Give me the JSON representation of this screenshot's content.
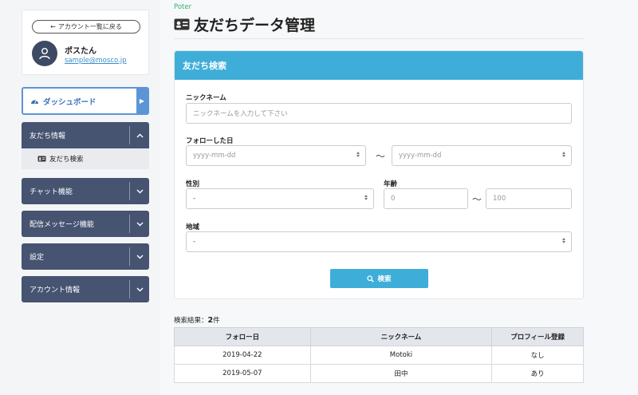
{
  "sidebar": {
    "back_label": "アカウント一覧に戻る",
    "user_name": "ポスたん",
    "user_email": "sample@mosco.jp",
    "dashboard_label": "ダッシュボード",
    "menu": [
      {
        "label": "友だち情報"
      },
      {
        "label": "チャット機能"
      },
      {
        "label": "配信メッセージ機能"
      },
      {
        "label": "設定"
      },
      {
        "label": "アカウント情報"
      }
    ],
    "submenu_item": "友だち検索",
    "accent_color": "#465371"
  },
  "header": {
    "app_name": "Poter",
    "page_title": "友だちデータ管理"
  },
  "search": {
    "panel_title": "友だち検索",
    "nickname_label": "ニックネーム",
    "nickname_placeholder": "ニックネームを入力して下さい",
    "follow_date_label": "フォローした日",
    "date_from_placeholder": "yyyy-mm-dd",
    "date_to_placeholder": "yyyy-mm-dd",
    "range_sep": "〜",
    "gender_label": "性別",
    "gender_value": "-",
    "age_label": "年齢",
    "age_from": "0",
    "age_to": "100",
    "region_label": "地域",
    "region_value": "-",
    "search_button": "検索",
    "accent_color": "#3eaed8"
  },
  "results": {
    "label": "検索結果：",
    "count": "2",
    "unit": "件",
    "columns": [
      "フォロー日",
      "ニックネーム",
      "プロフィール登録"
    ],
    "rows": [
      [
        "2019-04-22",
        "Motoki",
        "なし"
      ],
      [
        "2019-05-07",
        "田中",
        "あり"
      ]
    ]
  }
}
